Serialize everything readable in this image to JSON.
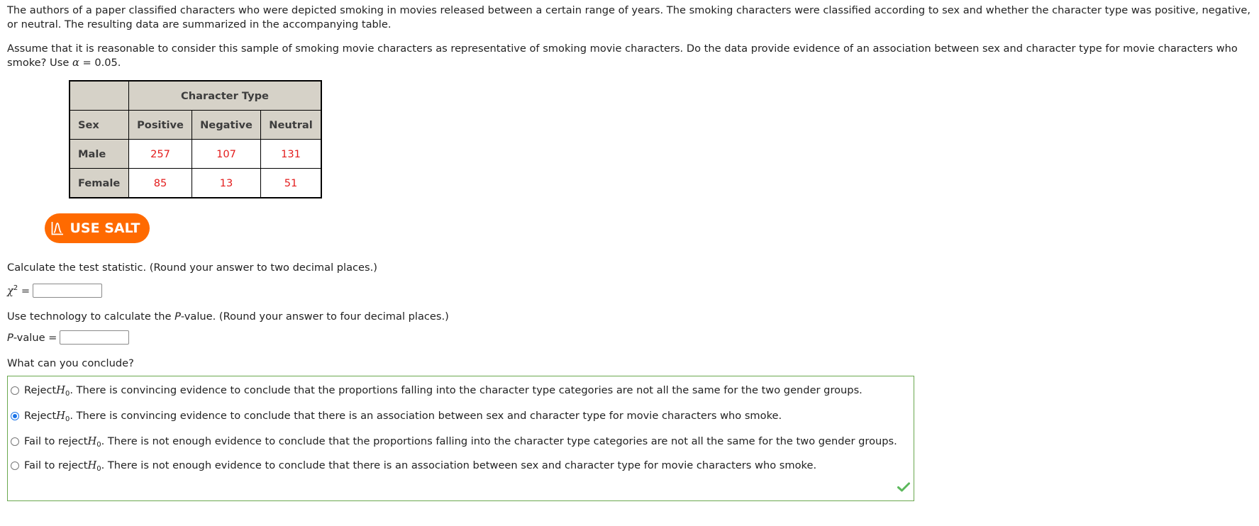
{
  "intro": {
    "paragraph1": "The authors of a paper classified characters who were depicted smoking in movies released between a certain range of years. The smoking characters were classified according to sex and whether the character type was positive, negative, or neutral. The resulting data are summarized in the accompanying table.",
    "paragraph2_prefix": "Assume that it is reasonable to consider this sample of smoking movie characters as representative of smoking movie characters. Do the data provide evidence of an association between sex and character type for movie characters who smoke? Use ",
    "alpha_symbol": "α",
    "paragraph2_suffix": " = 0.05."
  },
  "table": {
    "group_header": "Character Type",
    "row_header_label": "Sex",
    "columns": [
      "Positive",
      "Negative",
      "Neutral"
    ],
    "rows": [
      {
        "label": "Male",
        "values": [
          "257",
          "107",
          "131"
        ]
      },
      {
        "label": "Female",
        "values": [
          "85",
          "13",
          "51"
        ]
      }
    ]
  },
  "salt_button": {
    "label": "USE SALT",
    "icon": "distribution-curve-icon",
    "color": "#ff6a00"
  },
  "questions": {
    "test_statistic_prompt": "Calculate the test statistic. (Round your answer to two decimal places.)",
    "chi_symbol": "χ",
    "chi_exponent": "2",
    "equals": " =",
    "chi_value": "",
    "pvalue_prompt_prefix": "Use technology to calculate the ",
    "pvalue_prompt_italic": "P",
    "pvalue_prompt_suffix": "-value. (Round your answer to four decimal places.)",
    "pvalue_label_italic": "P",
    "pvalue_label_suffix": "-value =",
    "pvalue_value": "",
    "conclude_prompt": "What can you conclude?"
  },
  "options": [
    {
      "lead": "Reject ",
      "h": "H",
      "sub": "0",
      "text": ". There is convincing evidence to conclude that the proportions falling into the character type categories are not all the same for the two gender groups.",
      "selected": false
    },
    {
      "lead": "Reject ",
      "h": "H",
      "sub": "0",
      "text": ". There is convincing evidence to conclude that there is an association between sex and character type for movie characters who smoke.",
      "selected": true
    },
    {
      "lead": "Fail to reject ",
      "h": "H",
      "sub": "0",
      "text": ". There is not enough evidence to conclude that the proportions falling into the character type categories are not all the same for the two gender groups.",
      "selected": false
    },
    {
      "lead": "Fail to reject ",
      "h": "H",
      "sub": "0",
      "text": ". There is not enough evidence to conclude that there is an association between sex and character type for movie characters who smoke.",
      "selected": false
    }
  ],
  "status": {
    "icon": "check-icon",
    "correct": true,
    "box_border_color": "#6aa84f",
    "check_color": "#5cb85c"
  }
}
